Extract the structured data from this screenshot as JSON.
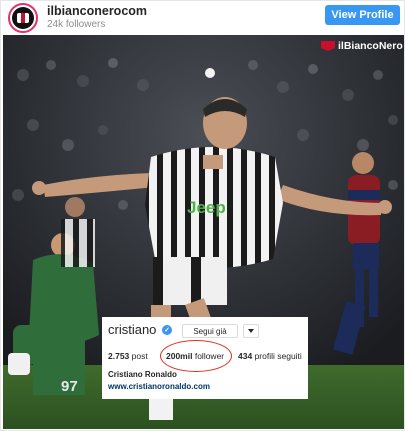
{
  "header": {
    "username": "ilbianconerocom",
    "followers": "24k followers",
    "view_profile": "View Profile"
  },
  "photo": {
    "brand": "ilBiancoNero",
    "sponsor": "Jeep",
    "keeper_number": "97"
  },
  "profile_card": {
    "handle": "cristiano",
    "follow_label": "Segui già",
    "posts_value": "2.753",
    "posts_label": "post",
    "followers_value": "200mil",
    "followers_label": "follower",
    "following_value": "434",
    "following_label": "profili seguiti",
    "full_name": "Cristiano Ronaldo",
    "website": "www.cristianoronaldo.com"
  },
  "colors": {
    "accent": "#3897f0",
    "highlight": "#e0301e",
    "brand_red": "#c8102e"
  }
}
